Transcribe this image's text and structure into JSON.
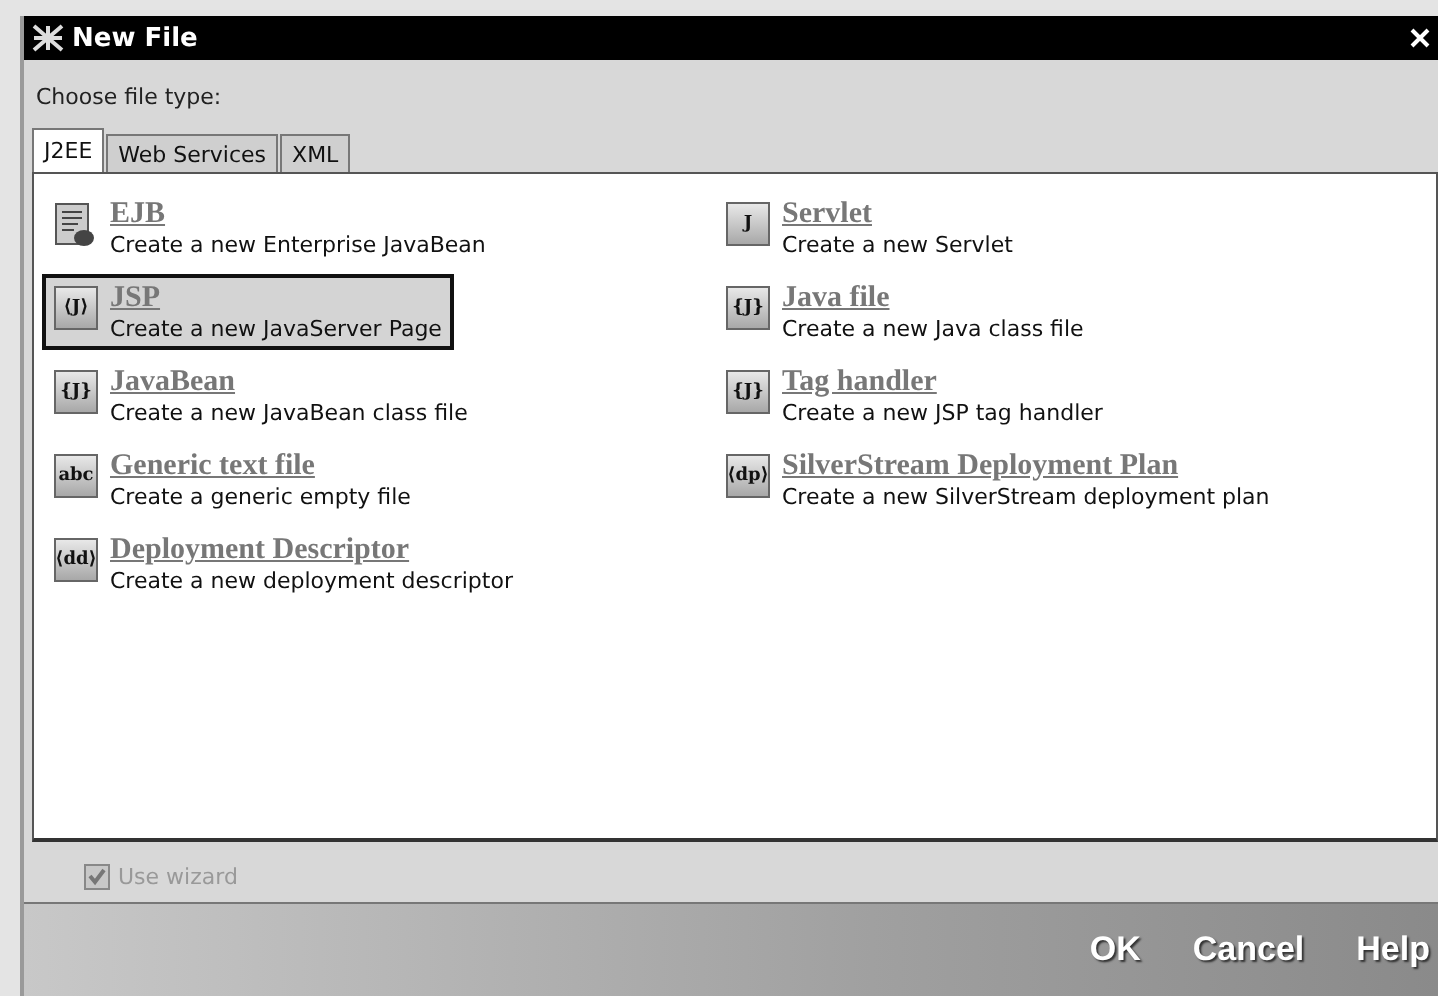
{
  "window": {
    "title": "New File"
  },
  "prompt": "Choose file type:",
  "tabs": [
    {
      "label": "J2EE",
      "selected": true
    },
    {
      "label": "Web Services",
      "selected": false
    },
    {
      "label": "XML",
      "selected": false
    }
  ],
  "columns": [
    [
      {
        "name": "EJB",
        "description": "Create a new Enterprise JavaBean",
        "kind": "document",
        "selected": false
      },
      {
        "name": "JSP",
        "description": "Create a new JavaServer Page",
        "kind": "glyph",
        "glyph": "⟨J⟩",
        "selected": true
      },
      {
        "name": "JavaBean",
        "description": "Create a new JavaBean class file",
        "kind": "glyph",
        "glyph": "{J}",
        "selected": false
      },
      {
        "name": "Generic text file",
        "description": "Create a generic empty file",
        "kind": "glyph",
        "glyph": "abc",
        "selected": false
      },
      {
        "name": "Deployment Descriptor",
        "description": "Create a new deployment descriptor",
        "kind": "glyph",
        "glyph": "⟨dd⟩",
        "selected": false
      }
    ],
    [
      {
        "name": "Servlet",
        "description": "Create a new Servlet",
        "kind": "glyph",
        "glyph": "J",
        "selected": false
      },
      {
        "name": "Java file",
        "description": "Create a new Java class file",
        "kind": "glyph",
        "glyph": "{J}",
        "selected": false
      },
      {
        "name": "Tag handler",
        "description": "Create a new JSP tag handler",
        "kind": "glyph",
        "glyph": "{J}",
        "selected": false
      },
      {
        "name": "SilverStream Deployment Plan",
        "description": "Create a new SilverStream deployment plan",
        "kind": "glyph",
        "glyph": "⟨dp⟩",
        "selected": false
      }
    ]
  ],
  "use_wizard": {
    "label": "Use wizard",
    "checked": true,
    "disabled": true
  },
  "buttons": [
    "OK",
    "Cancel",
    "Help"
  ]
}
